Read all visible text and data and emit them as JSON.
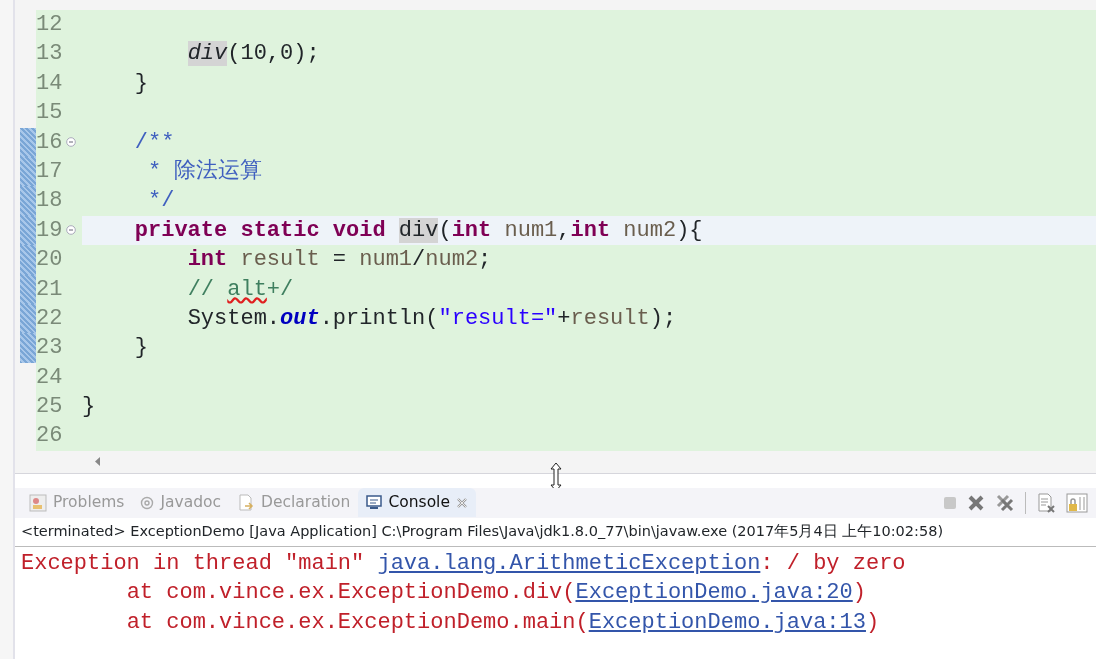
{
  "editor": {
    "lines": [
      {
        "number": "12",
        "current": false,
        "changed": false,
        "fold": false
      },
      {
        "number": "13",
        "current": false,
        "changed": false,
        "fold": false,
        "tokens": [
          {
            "kind": "method-call",
            "text": "        div",
            "occurrence": true
          },
          {
            "kind": "plain",
            "text": "(10,0);"
          }
        ]
      },
      {
        "number": "14",
        "current": false,
        "changed": false,
        "fold": false,
        "tokens": [
          {
            "kind": "plain",
            "text": "    }"
          }
        ]
      },
      {
        "number": "15",
        "current": false,
        "changed": false,
        "fold": false
      },
      {
        "number": "16",
        "current": false,
        "changed": true,
        "fold": true,
        "tokens": [
          {
            "kind": "javadoc",
            "text": "    /**"
          }
        ]
      },
      {
        "number": "17",
        "current": false,
        "changed": true,
        "fold": false,
        "tokens": [
          {
            "kind": "javadoc",
            "text": "     * 除法运算"
          }
        ]
      },
      {
        "number": "18",
        "current": false,
        "changed": true,
        "fold": false,
        "tokens": [
          {
            "kind": "javadoc",
            "text": "     */"
          }
        ]
      },
      {
        "number": "19",
        "current": true,
        "changed": true,
        "fold": true,
        "tokens": [
          {
            "kind": "keyword",
            "text": "    private static void"
          },
          {
            "kind": "plain",
            "text": " div",
            "occurrence": true
          },
          {
            "kind": "plain",
            "text": "("
          },
          {
            "kind": "keyword",
            "text": "int"
          },
          {
            "kind": "variable",
            "text": " num1"
          },
          {
            "kind": "plain",
            "text": ","
          },
          {
            "kind": "keyword",
            "text": "int"
          },
          {
            "kind": "variable",
            "text": " num2"
          },
          {
            "kind": "plain",
            "text": "){"
          }
        ]
      },
      {
        "number": "20",
        "current": false,
        "changed": true,
        "fold": false,
        "tokens": [
          {
            "kind": "keyword",
            "text": "        int"
          },
          {
            "kind": "variable",
            "text": " result"
          },
          {
            "kind": "plain",
            "text": " = "
          },
          {
            "kind": "variable",
            "text": "num1"
          },
          {
            "kind": "plain",
            "text": "/"
          },
          {
            "kind": "variable",
            "text": "num2"
          },
          {
            "kind": "plain",
            "text": ";"
          }
        ]
      },
      {
        "number": "21",
        "current": false,
        "changed": true,
        "fold": false,
        "tokens": [
          {
            "kind": "comment",
            "text": "        //"
          },
          {
            "kind": "misspelled",
            "text": " alt"
          },
          {
            "kind": "comment",
            "text": "+/"
          }
        ]
      },
      {
        "number": "22",
        "current": false,
        "changed": true,
        "fold": false,
        "tokens": [
          {
            "kind": "plain",
            "text": "        System."
          },
          {
            "kind": "field",
            "text": "out"
          },
          {
            "kind": "plain",
            "text": ".println("
          },
          {
            "kind": "string",
            "text": "\"result=\""
          },
          {
            "kind": "plain",
            "text": "+"
          },
          {
            "kind": "variable",
            "text": "result"
          },
          {
            "kind": "plain",
            "text": ");"
          }
        ]
      },
      {
        "number": "23",
        "current": false,
        "changed": true,
        "fold": false,
        "tokens": [
          {
            "kind": "plain",
            "text": "    }"
          }
        ]
      },
      {
        "number": "24",
        "current": false,
        "changed": false,
        "fold": false
      },
      {
        "number": "25",
        "current": false,
        "changed": false,
        "fold": false,
        "tokens": [
          {
            "kind": "plain",
            "text": "}"
          }
        ]
      },
      {
        "number": "26",
        "current": false,
        "changed": false,
        "fold": false
      }
    ]
  },
  "views": {
    "tabs": [
      {
        "label": "Problems",
        "selected": false
      },
      {
        "label": "Javadoc",
        "selected": false
      },
      {
        "label": "Declaration",
        "selected": false
      },
      {
        "label": "Console",
        "selected": true
      }
    ]
  },
  "console": {
    "header": "<terminated> ExceptionDemo [Java Application] C:\\Program Files\\Java\\jdk1.8.0_77\\bin\\javaw.exe (2017年5月4日 上午10:02:58)",
    "output": [
      [
        {
          "kind": "text",
          "text": "Exception in thread \"main\" "
        },
        {
          "kind": "link",
          "text": "java.lang.ArithmeticException"
        },
        {
          "kind": "text",
          "text": ": / by zero"
        }
      ],
      [
        {
          "kind": "text",
          "text": "        at com.vince.ex.ExceptionDemo.div("
        },
        {
          "kind": "link",
          "text": "ExceptionDemo.java:20"
        },
        {
          "kind": "text",
          "text": ")"
        }
      ],
      [
        {
          "kind": "text",
          "text": "        at com.vince.ex.ExceptionDemo.main("
        },
        {
          "kind": "link",
          "text": "ExceptionDemo.java:13"
        },
        {
          "kind": "text",
          "text": ")"
        }
      ]
    ]
  }
}
